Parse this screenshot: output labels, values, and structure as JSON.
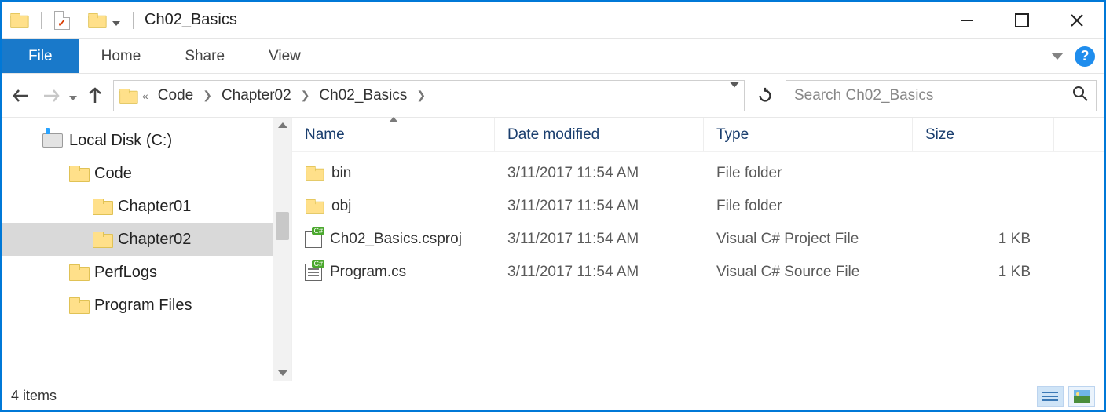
{
  "title": "Ch02_Basics",
  "ribbon": {
    "file": "File",
    "tabs": [
      "Home",
      "Share",
      "View"
    ]
  },
  "breadcrumb": [
    "Code",
    "Chapter02",
    "Ch02_Basics"
  ],
  "search": {
    "placeholder": "Search Ch02_Basics"
  },
  "tree": [
    {
      "label": "Local Disk (C:)",
      "indent": 52,
      "icon": "drive",
      "selected": false
    },
    {
      "label": "Code",
      "indent": 86,
      "icon": "folder",
      "selected": false
    },
    {
      "label": "Chapter01",
      "indent": 116,
      "icon": "folder",
      "selected": false
    },
    {
      "label": "Chapter02",
      "indent": 116,
      "icon": "folder",
      "selected": true
    },
    {
      "label": "PerfLogs",
      "indent": 86,
      "icon": "folder",
      "selected": false
    },
    {
      "label": "Program Files",
      "indent": 86,
      "icon": "folder",
      "selected": false
    }
  ],
  "columns": {
    "name": "Name",
    "date": "Date modified",
    "type": "Type",
    "size": "Size",
    "sorted": "name",
    "dir": "asc"
  },
  "rows": [
    {
      "icon": "folder",
      "name": "bin",
      "date": "3/11/2017 11:54 AM",
      "type": "File folder",
      "size": ""
    },
    {
      "icon": "folder",
      "name": "obj",
      "date": "3/11/2017 11:54 AM",
      "type": "File folder",
      "size": ""
    },
    {
      "icon": "csproj",
      "name": "Ch02_Basics.csproj",
      "date": "3/11/2017 11:54 AM",
      "type": "Visual C# Project File",
      "size": "1 KB"
    },
    {
      "icon": "cs",
      "name": "Program.cs",
      "date": "3/11/2017 11:54 AM",
      "type": "Visual C# Source File",
      "size": "1 KB"
    }
  ],
  "status": "4 items"
}
